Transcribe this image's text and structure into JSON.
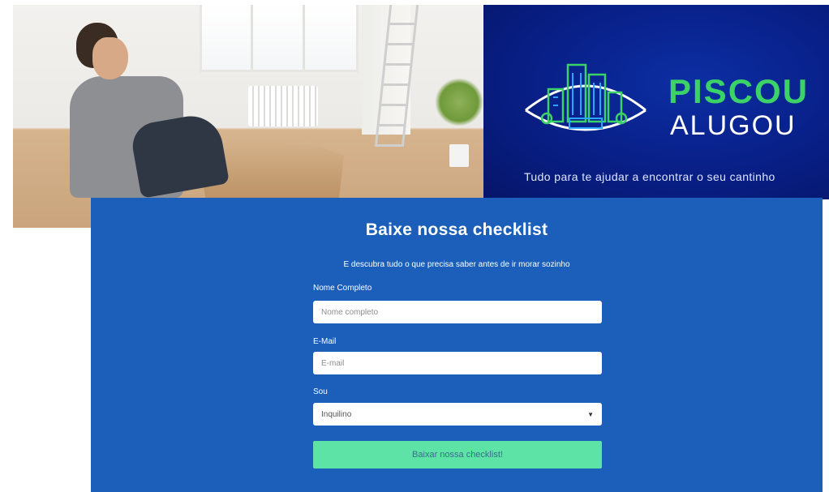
{
  "brand": {
    "word1": "PISCOU",
    "word2": "ALUGOU",
    "tagline": "Tudo para te ajudar a encontrar o seu cantinho",
    "logo_icon": "city-eye-icon",
    "colors": {
      "background": "#081f86",
      "accent": "#3bd267",
      "text": "#ffffff"
    }
  },
  "hero": {
    "photo_icon": "man-sitting-with-box-photo"
  },
  "form": {
    "title": "Baixe nossa checklist",
    "subtitle": "E descubra tudo o que precisa saber antes de ir morar sozinho",
    "name_label": "Nome Completo",
    "name_placeholder": "Nome completo",
    "name_value": "",
    "email_label": "E-Mail",
    "email_placeholder": "E-mail",
    "email_value": "",
    "role_label": "Sou",
    "role_selected": "Inquilino",
    "submit_label": "Baixar nossa checklist!",
    "colors": {
      "panel": "#1b5fba",
      "button": "#5ee3a7",
      "button_text": "#3a6d8c"
    }
  }
}
